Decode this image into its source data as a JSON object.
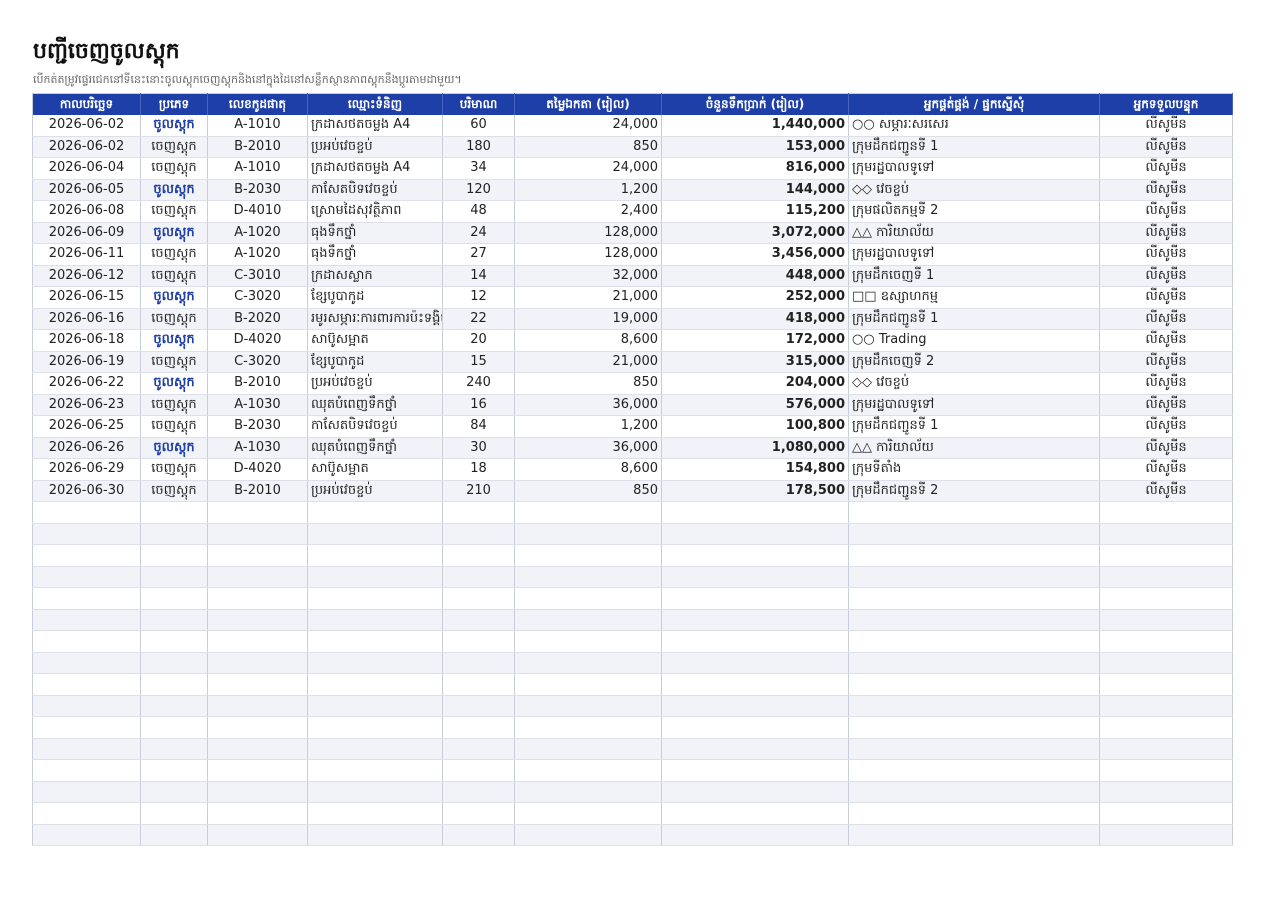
{
  "title": "បញ្ជីចេញចូលស្តុក",
  "subtitle": "បើកត់តម្រូវផ្ទេរជេកនៅទីនេះនោះចូលស្តុកចេញស្តុកនិងនៅក្នុងដៃនៅសន្លឹកស្ថានភាពស្តុកនឹងប្តូរតាមដាមួយ។",
  "colors": {
    "header_bg": "#1f3fa8",
    "in_text": "#1f3fa8",
    "stripe": "#f1f3f8"
  },
  "headers": [
    "កាលបរិច្ឆេទ",
    "ប្រភេទ",
    "លេខកូដផាតុ",
    "ឈ្មោះទំនិញ",
    "បរិមាណ",
    "តម្លៃឯកតា (រៀល)",
    "ចំនួនទឹកប្រាក់ (រៀល)",
    "អ្នកផ្គត់ផ្គង់ / ផ្នកស្នើសុំ",
    "អ្នកទទួលបន្ទុក"
  ],
  "rows": [
    {
      "date": "2026-06-02",
      "type": "ចូលស្តុក",
      "in": true,
      "code": "A-1010",
      "name": "ក្រដាសថតចម្លង A4",
      "qty": "60",
      "price": "24,000",
      "amount": "1,440,000",
      "party": "○○ សម្ភារៈសរសេរ",
      "owner": "លីសូមីន"
    },
    {
      "date": "2026-06-02",
      "type": "ចេញស្តុក",
      "in": false,
      "code": "B-2010",
      "name": "ប្រអប់វេចខ្ចប់",
      "qty": "180",
      "price": "850",
      "amount": "153,000",
      "party": "ក្រុមដឹកជញ្ជូនទី 1",
      "owner": "លីសូមីន"
    },
    {
      "date": "2026-06-04",
      "type": "ចេញស្តុក",
      "in": false,
      "code": "A-1010",
      "name": "ក្រដាសថតចម្លង A4",
      "qty": "34",
      "price": "24,000",
      "amount": "816,000",
      "party": "ក្រុមរដ្ឋបាលទូទៅ",
      "owner": "លីសូមីន"
    },
    {
      "date": "2026-06-05",
      "type": "ចូលស្តុក",
      "in": true,
      "code": "B-2030",
      "name": "កាសែតបិទវេចខ្ចប់",
      "qty": "120",
      "price": "1,200",
      "amount": "144,000",
      "party": "◇◇ វេចខ្ចប់",
      "owner": "លីសូមីន"
    },
    {
      "date": "2026-06-08",
      "type": "ចេញស្តុក",
      "in": false,
      "code": "D-4010",
      "name": "ស្រោមដៃសុវត្ថិភាព",
      "qty": "48",
      "price": "2,400",
      "amount": "115,200",
      "party": "ក្រុមផលិតកម្មទី 2",
      "owner": "លីសូមីន"
    },
    {
      "date": "2026-06-09",
      "type": "ចូលស្តុក",
      "in": true,
      "code": "A-1020",
      "name": "ធុងទឹកថ្នាំ",
      "qty": "24",
      "price": "128,000",
      "amount": "3,072,000",
      "party": "△△ ការិយាល័យ",
      "owner": "លីសូមីន"
    },
    {
      "date": "2026-06-11",
      "type": "ចេញស្តុក",
      "in": false,
      "code": "A-1020",
      "name": "ធុងទឹកថ្នាំ",
      "qty": "27",
      "price": "128,000",
      "amount": "3,456,000",
      "party": "ក្រុមរដ្ឋបាលទូទៅ",
      "owner": "លីសូមីន"
    },
    {
      "date": "2026-06-12",
      "type": "ចេញស្តុក",
      "in": false,
      "code": "C-3010",
      "name": "ក្រដាសស្លាក",
      "qty": "14",
      "price": "32,000",
      "amount": "448,000",
      "party": "ក្រុមដឹកចេញទី 1",
      "owner": "លីសូមីន"
    },
    {
      "date": "2026-06-15",
      "type": "ចូលស្តុក",
      "in": true,
      "code": "C-3020",
      "name": "ខ្សែបូបាកូដ",
      "qty": "12",
      "price": "21,000",
      "amount": "252,000",
      "party": "□□ ឧស្សាហកម្ម",
      "owner": "លីសូមីន"
    },
    {
      "date": "2026-06-16",
      "type": "ចេញស្តុក",
      "in": false,
      "code": "B-2020",
      "name": "រមូរសម្ភារៈការពារការប៉ះទង្គិច",
      "qty": "22",
      "price": "19,000",
      "amount": "418,000",
      "party": "ក្រុមដឹកជញ្ជូនទី 1",
      "owner": "លីសូមីន"
    },
    {
      "date": "2026-06-18",
      "type": "ចូលស្តុក",
      "in": true,
      "code": "D-4020",
      "name": "សាប៊ូសម្អាត",
      "qty": "20",
      "price": "8,600",
      "amount": "172,000",
      "party": "○○ Trading",
      "owner": "លីសូមីន"
    },
    {
      "date": "2026-06-19",
      "type": "ចេញស្តុក",
      "in": false,
      "code": "C-3020",
      "name": "ខ្សែបូបាកូដ",
      "qty": "15",
      "price": "21,000",
      "amount": "315,000",
      "party": "ក្រុមដឹកចេញទី 2",
      "owner": "លីសូមីន"
    },
    {
      "date": "2026-06-22",
      "type": "ចូលស្តុក",
      "in": true,
      "code": "B-2010",
      "name": "ប្រអប់វេចខ្ចប់",
      "qty": "240",
      "price": "850",
      "amount": "204,000",
      "party": "◇◇ វេចខ្ចប់",
      "owner": "លីសូមីន"
    },
    {
      "date": "2026-06-23",
      "type": "ចេញស្តុក",
      "in": false,
      "code": "A-1030",
      "name": "ឈុតបំពេញទឹកថ្នាំ",
      "qty": "16",
      "price": "36,000",
      "amount": "576,000",
      "party": "ក្រុមរដ្ឋបាលទូទៅ",
      "owner": "លីសូមីន"
    },
    {
      "date": "2026-06-25",
      "type": "ចេញស្តុក",
      "in": false,
      "code": "B-2030",
      "name": "កាសែតបិទវេចខ្ចប់",
      "qty": "84",
      "price": "1,200",
      "amount": "100,800",
      "party": "ក្រុមដឹកជញ្ជូនទី 1",
      "owner": "លីសូមីន"
    },
    {
      "date": "2026-06-26",
      "type": "ចូលស្តុក",
      "in": true,
      "code": "A-1030",
      "name": "ឈុតបំពេញទឹកថ្នាំ",
      "qty": "30",
      "price": "36,000",
      "amount": "1,080,000",
      "party": "△△ ការិយាល័យ",
      "owner": "លីសូមីន"
    },
    {
      "date": "2026-06-29",
      "type": "ចេញស្តុក",
      "in": false,
      "code": "D-4020",
      "name": "សាប៊ូសម្អាត",
      "qty": "18",
      "price": "8,600",
      "amount": "154,800",
      "party": "ក្រុមទីតាំង",
      "owner": "លីសូមីន"
    },
    {
      "date": "2026-06-30",
      "type": "ចេញស្តុក",
      "in": false,
      "code": "B-2010",
      "name": "ប្រអប់វេចខ្ចប់",
      "qty": "210",
      "price": "850",
      "amount": "178,500",
      "party": "ក្រុមដឹកជញ្ជូនទី 2",
      "owner": "លីសូមីន"
    }
  ]
}
